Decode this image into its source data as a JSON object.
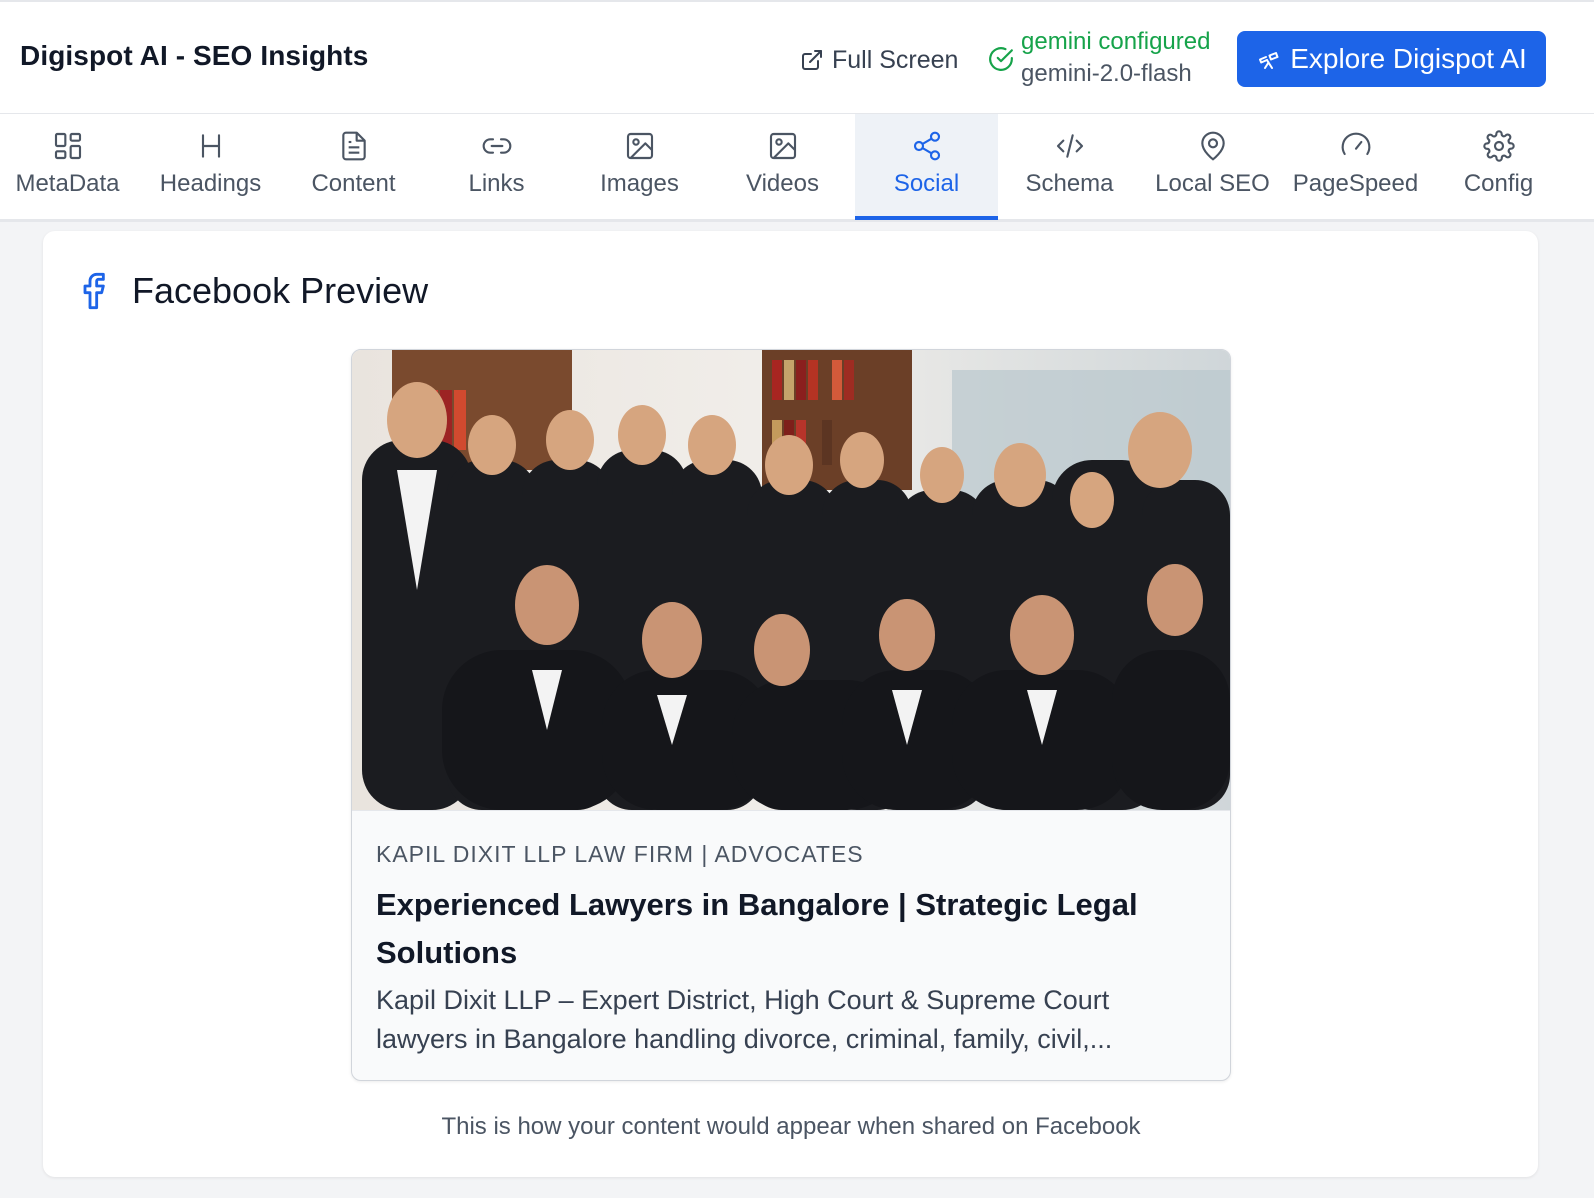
{
  "header": {
    "title": "Digispot AI - SEO Insights",
    "fullscreen_label": "Full Screen",
    "status_text": "gemini configured",
    "model_name": "gemini-2.0-flash",
    "explore_label": "Explore Digispot AI",
    "accent_color": "#1d64e8",
    "status_color": "#16a34a"
  },
  "tabs": [
    {
      "label": "MetaData",
      "icon": "grid-icon"
    },
    {
      "label": "Headings",
      "icon": "heading-icon"
    },
    {
      "label": "Content",
      "icon": "document-icon"
    },
    {
      "label": "Links",
      "icon": "link-icon"
    },
    {
      "label": "Images",
      "icon": "image-icon"
    },
    {
      "label": "Videos",
      "icon": "image-icon"
    },
    {
      "label": "Social",
      "icon": "share-icon",
      "active": true
    },
    {
      "label": "Schema",
      "icon": "code-icon"
    },
    {
      "label": "Local SEO",
      "icon": "map-pin-icon"
    },
    {
      "label": "PageSpeed",
      "icon": "gauge-icon"
    },
    {
      "label": "Config",
      "icon": "gear-icon"
    }
  ],
  "social": {
    "section_title": "Facebook Preview",
    "section_icon": "facebook-icon",
    "preview": {
      "image": "team-photo",
      "site_name": "KAPIL DIXIT LLP LAW FIRM | ADVOCATES",
      "title": "Experienced Lawyers in Bangalore | Strategic Legal Solutions",
      "description": "Kapil Dixit LLP – Expert District, High Court & Supreme Court lawyers in Bangalore handling divorce, criminal, family, civil,..."
    },
    "caption": "This is how your content would appear when shared on Facebook"
  }
}
